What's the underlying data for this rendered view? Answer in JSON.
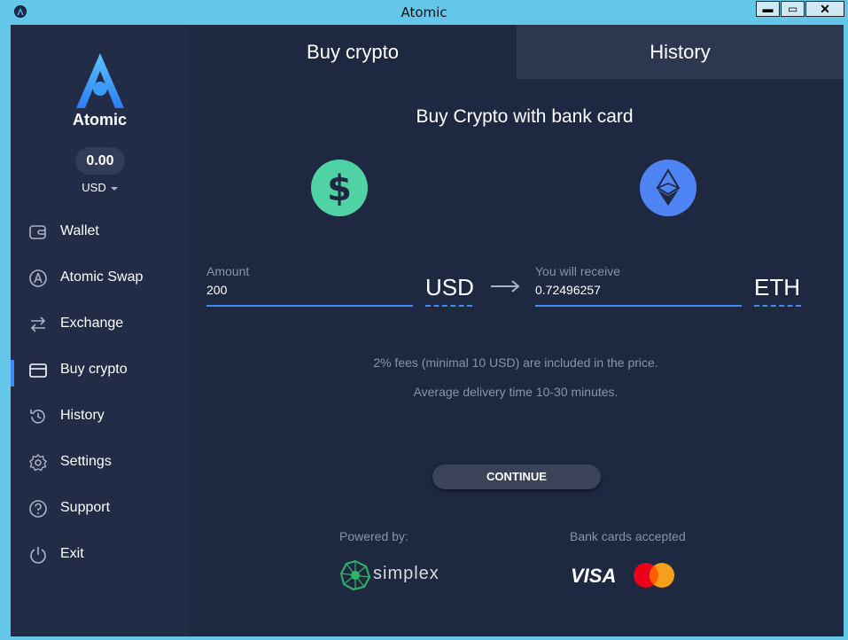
{
  "window": {
    "title": "Atomic",
    "minimize": "▬",
    "maximize": "▭",
    "close": "✕"
  },
  "sidebar": {
    "brand": "Atomic",
    "balance": "0.00",
    "currency": "USD",
    "items": [
      {
        "label": "Wallet",
        "icon": "wallet-icon"
      },
      {
        "label": "Atomic Swap",
        "icon": "atomic-swap-icon"
      },
      {
        "label": "Exchange",
        "icon": "exchange-icon"
      },
      {
        "label": "Buy crypto",
        "icon": "card-icon",
        "active": true
      },
      {
        "label": "History",
        "icon": "history-icon"
      },
      {
        "label": "Settings",
        "icon": "gear-icon"
      },
      {
        "label": "Support",
        "icon": "help-icon"
      },
      {
        "label": "Exit",
        "icon": "power-icon"
      }
    ]
  },
  "tabs": {
    "buy": "Buy crypto",
    "history": "History"
  },
  "main": {
    "heading": "Buy Crypto with bank card",
    "amount_label": "Amount",
    "amount_value": "200",
    "from_unit": "USD",
    "receive_label": "You will receive",
    "receive_value": "0.72496257",
    "to_unit": "ETH",
    "fee_note": "2% fees (minimal 10 USD) are included in the price.",
    "delivery_note": "Average delivery time 10-30 minutes.",
    "continue_label": "CONTINUE",
    "powered_by_label": "Powered by:",
    "powered_by_name": "simplex",
    "cards_label": "Bank cards accepted",
    "visa_label": "VISA"
  },
  "colors": {
    "accent": "#3a8dfa",
    "sidebar_bg": "#232c46",
    "main_bg": "#1e2840",
    "usd_coin": "#4fd2a4",
    "eth_coin": "#4f84f4"
  }
}
